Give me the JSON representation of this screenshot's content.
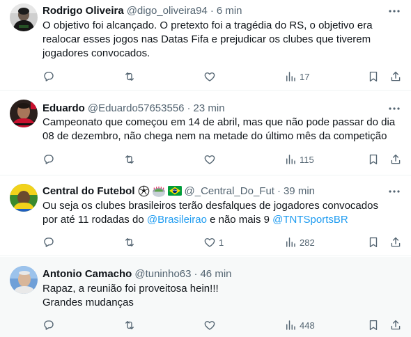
{
  "colors": {
    "text": "#0f1419",
    "secondary": "#536471",
    "link": "#1d9bf0",
    "divider": "#eff3f4",
    "highlight_bg": "#f7f9f9"
  },
  "tweets": [
    {
      "name": "Rodrigo Oliveira",
      "handle": "@digo_oliveira94",
      "separator": "·",
      "time": "6 min",
      "lines": [
        "O objetivo foi alcançado. O pretexto foi a tragédia do RS, o objetivo era",
        "realocar esses jogos nas Datas Fifa e prejudicar os clubes que tiverem",
        "jogadores convocados."
      ],
      "views": "17",
      "icons": {
        "reply": "reply-icon",
        "retweet": "retweet-icon",
        "like": "like-icon",
        "views": "views-icon",
        "bookmark": "bookmark-icon",
        "share": "share-icon",
        "more": "more-icon"
      }
    },
    {
      "name": "Eduardo",
      "handle": "@Eduardo57653556",
      "separator": "·",
      "time": "23 min",
      "lines": [
        "Campeonato que começou em 14 de abril, mas que não pode passar do dia",
        "08 de dezembro, não chega nem na metade do último mês da competição"
      ],
      "views": "115"
    },
    {
      "name": "Central do Futebol",
      "name_emojis": [
        "soccer-ball-emoji",
        "stadium-emoji",
        "brazil-flag-emoji"
      ],
      "handle": "@_Central_Do_Fut",
      "separator": "·",
      "time": "39 min",
      "line1": "Ou seja os clubes brasileiros terão desfalques de jogadores convocados",
      "line2_a": "por até 11 rodadas do ",
      "line2_mention1": "@Brasileirao",
      "line2_b": " e não mais 9 ",
      "line2_mention2": "@TNTSportsBR",
      "likes": "1",
      "views": "282"
    },
    {
      "name": "Antonio Camacho",
      "handle": "@tuninho63",
      "separator": "·",
      "time": "46 min",
      "lines": [
        "Rapaz, a reunião foi proveitosa hein!!!",
        "Grandes mudanças"
      ],
      "views": "448"
    }
  ]
}
